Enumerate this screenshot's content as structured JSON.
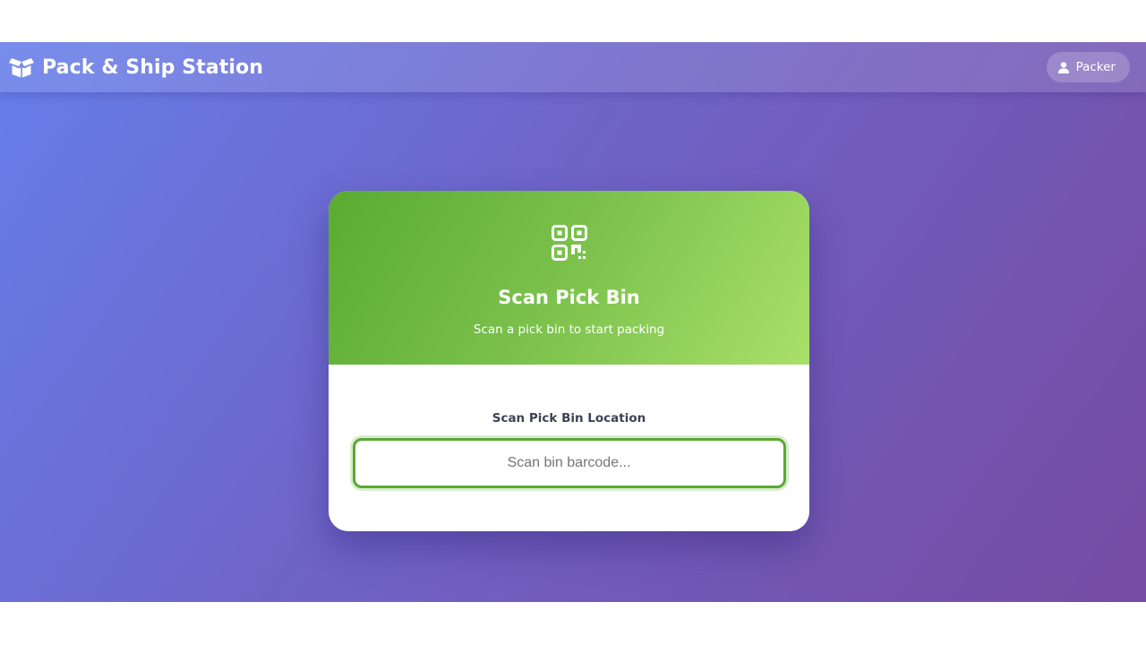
{
  "header": {
    "brand_icon": "box-open-icon",
    "title": "Pack & Ship Station",
    "user": {
      "icon": "user-icon",
      "label": "Packer"
    }
  },
  "card": {
    "icon": "qr-code-icon",
    "title": "Scan Pick Bin",
    "subtitle": "Scan a pick bin to start packing",
    "field_label": "Scan Pick Bin Location",
    "input": {
      "value": "",
      "placeholder": "Scan bin barcode..."
    }
  },
  "colors": {
    "background_start": "#667eea",
    "background_end": "#764ba2",
    "card_header_start": "#5aab32",
    "card_header_end": "#a9e06a",
    "input_border": "#5aa832"
  }
}
